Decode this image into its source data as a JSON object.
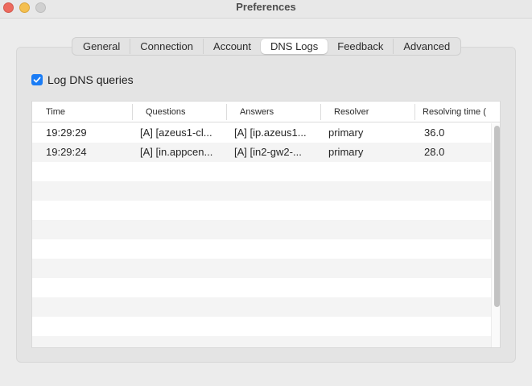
{
  "window": {
    "title": "Preferences"
  },
  "tabs": [
    {
      "label": "General"
    },
    {
      "label": "Connection"
    },
    {
      "label": "Account"
    },
    {
      "label": "DNS Logs",
      "active": true
    },
    {
      "label": "Feedback"
    },
    {
      "label": "Advanced"
    }
  ],
  "log_option": {
    "label": "Log DNS queries",
    "checked": true
  },
  "table": {
    "columns": [
      "Time",
      "Questions",
      "Answers",
      "Resolver",
      "Resolving time ("
    ],
    "rows": [
      [
        "19:29:29",
        "[A] [azeus1-cl...",
        "[A] [ip.azeus1...",
        "primary",
        "36.0"
      ],
      [
        "19:29:24",
        "[A] [in.appcen...",
        "[A] [in2-gw2-...",
        "primary",
        "28.0"
      ]
    ]
  },
  "colors": {
    "accent": "#1a7cf5",
    "close": "#ed6a5e",
    "minimize": "#f4bf4f",
    "zoom_disabled": "#d0d0d0"
  }
}
